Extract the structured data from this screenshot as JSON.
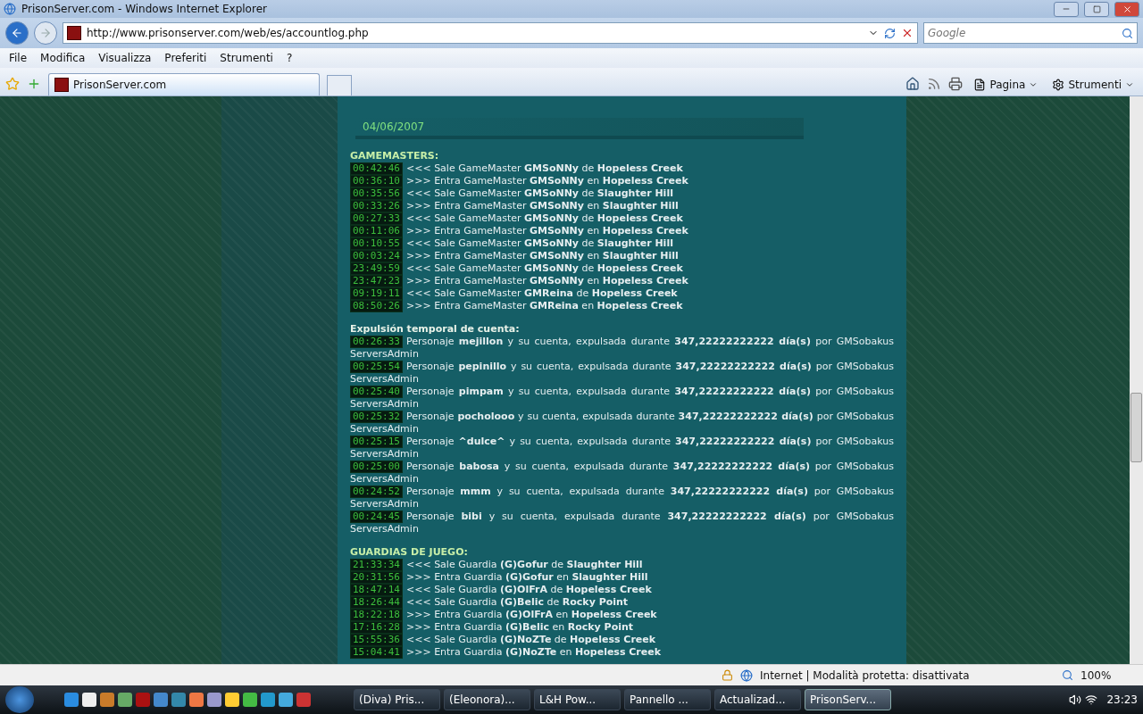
{
  "window": {
    "title": "PrisonServer.com - Windows Internet Explorer"
  },
  "address_bar": {
    "url": "http://www.prisonserver.com/web/es/accountlog.php"
  },
  "search": {
    "placeholder": "Google"
  },
  "menu": [
    "File",
    "Modifica",
    "Visualizza",
    "Preferiti",
    "Strumenti",
    "?"
  ],
  "tabs": [
    {
      "label": "PrisonServer.com",
      "selected": true
    }
  ],
  "command_bar": [
    {
      "label": "Pagina"
    },
    {
      "label": "Strumenti"
    }
  ],
  "page": {
    "date": "04/06/2007",
    "sections": [
      {
        "title": "GAMEMASTERS:",
        "kind": "log",
        "entries": [
          {
            "time": "00:42:46",
            "text": "<<< Sale GameMaster **GMSoNNy** de **Hopeless Creek**"
          },
          {
            "time": "00:36:10",
            "text": ">>> Entra GameMaster **GMSoNNy** en **Hopeless Creek**"
          },
          {
            "time": "00:35:56",
            "text": "<<< Sale GameMaster **GMSoNNy** de **Slaughter Hill**"
          },
          {
            "time": "00:33:26",
            "text": ">>> Entra GameMaster **GMSoNNy** en **Slaughter Hill**"
          },
          {
            "time": "00:27:33",
            "text": "<<< Sale GameMaster **GMSoNNy** de **Hopeless Creek**"
          },
          {
            "time": "00:11:06",
            "text": ">>> Entra GameMaster **GMSoNNy** en **Hopeless Creek**"
          },
          {
            "time": "00:10:55",
            "text": "<<< Sale GameMaster **GMSoNNy** de **Slaughter Hill**"
          },
          {
            "time": "00:03:24",
            "text": ">>> Entra GameMaster **GMSoNNy** en **Slaughter Hill**"
          },
          {
            "time": "23:49:59",
            "text": "<<< Sale GameMaster **GMSoNNy** de **Hopeless Creek**"
          },
          {
            "time": "23:47:23",
            "text": ">>> Entra GameMaster **GMSoNNy** en **Hopeless Creek**"
          },
          {
            "time": "09:19:11",
            "text": "<<< Sale GameMaster **GMReina** de **Hopeless Creek**"
          },
          {
            "time": "08:50:26",
            "text": ">>> Entra GameMaster **GMReina** en **Hopeless Creek**"
          }
        ]
      },
      {
        "title": "Expulsión temporal de cuenta:",
        "kind": "ban",
        "entries": [
          {
            "time": "00:26:33",
            "text": "Personaje **mejillon** y su cuenta, expulsada durante **347,22222222222 día(s)** por GMSobakus ServersAdmin"
          },
          {
            "time": "00:25:54",
            "text": "Personaje **pepinillo** y su cuenta, expulsada durante **347,22222222222 día(s)** por GMSobakus ServersAdmin"
          },
          {
            "time": "00:25:40",
            "text": "Personaje **pimpam** y su cuenta, expulsada durante **347,22222222222 día(s)** por GMSobakus ServersAdmin"
          },
          {
            "time": "00:25:32",
            "text": "Personaje **pocholooo** y su cuenta, expulsada durante **347,22222222222 día(s)** por GMSobakus ServersAdmin"
          },
          {
            "time": "00:25:15",
            "text": "Personaje **^dulce^** y su cuenta, expulsada durante **347,22222222222 día(s)** por GMSobakus ServersAdmin"
          },
          {
            "time": "00:25:00",
            "text": "Personaje **babosa** y su cuenta, expulsada durante **347,22222222222 día(s)** por GMSobakus ServersAdmin"
          },
          {
            "time": "00:24:52",
            "text": "Personaje **mmm** y su cuenta, expulsada durante **347,22222222222 día(s)** por GMSobakus ServersAdmin"
          },
          {
            "time": "00:24:45",
            "text": "Personaje **bibi** y su cuenta, expulsada durante **347,22222222222 día(s)** por GMSobakus ServersAdmin"
          }
        ]
      },
      {
        "title": "GUARDIAS DE JUEGO:",
        "kind": "log",
        "entries": [
          {
            "time": "21:33:34",
            "text": "<<< Sale Guardia **(G)Gofur** de **Slaughter Hill**"
          },
          {
            "time": "20:31:56",
            "text": ">>> Entra Guardia **(G)Gofur** en **Slaughter Hill**"
          },
          {
            "time": "18:47:14",
            "text": "<<< Sale Guardia **(G)OlFrA** de **Hopeless Creek**"
          },
          {
            "time": "18:26:44",
            "text": "<<< Sale Guardia **(G)Belic** de **Rocky Point**"
          },
          {
            "time": "18:22:18",
            "text": ">>> Entra Guardia **(G)OlFrA** en **Hopeless Creek**"
          },
          {
            "time": "17:16:28",
            "text": ">>> Entra Guardia **(G)Belic** en **Rocky Point**"
          },
          {
            "time": "15:55:36",
            "text": "<<< Sale Guardia **(G)NoZTe** de **Hopeless Creek**"
          },
          {
            "time": "15:04:41",
            "text": ">>> Entra Guardia **(G)NoZTe** en **Hopeless Creek**"
          }
        ]
      }
    ]
  },
  "status_bar": {
    "zone": "Internet | Modalità protetta: disattivata",
    "zoom": "100%"
  },
  "taskbar": {
    "tasks": [
      {
        "label": "(Diva) Pris...",
        "selected": false
      },
      {
        "label": "(Eleonora)...",
        "selected": false
      },
      {
        "label": "L&H Pow...",
        "selected": false
      },
      {
        "label": "Pannello ...",
        "selected": false
      },
      {
        "label": "Actualizad...",
        "selected": false
      },
      {
        "label": "PrisonServ...",
        "selected": true
      }
    ],
    "clock": "23:23"
  }
}
